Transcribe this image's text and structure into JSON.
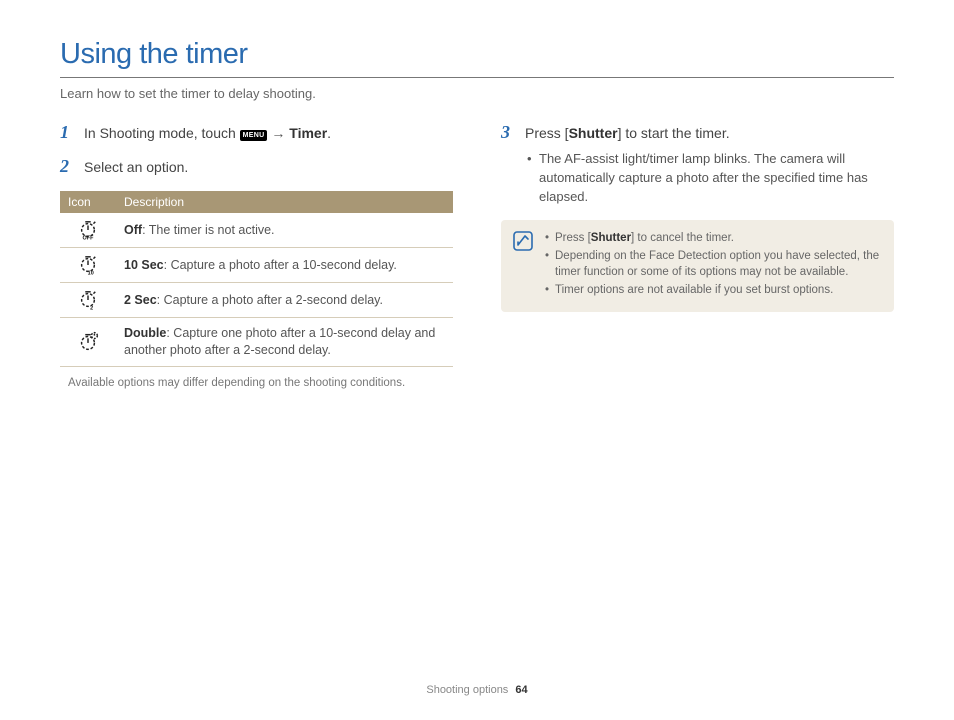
{
  "title": "Using the timer",
  "intro": "Learn how to set the timer to delay shooting.",
  "steps": {
    "s1": {
      "num": "1",
      "pre": "In Shooting mode, touch ",
      "menu": "MENU",
      "arrow": " → ",
      "target": "Timer",
      "post": "."
    },
    "s2": {
      "num": "2",
      "text": "Select an option."
    },
    "s3": {
      "num": "3",
      "pre": "Press [",
      "btn": "Shutter",
      "post": "] to start the timer.",
      "bullet": "The AF-assist light/timer lamp blinks. The camera will automatically capture a photo after the specified time has elapsed."
    }
  },
  "table": {
    "h1": "Icon",
    "h2": "Description",
    "rows": [
      {
        "label": "Off",
        "desc": ": The timer is not active."
      },
      {
        "label": "10 Sec",
        "desc": ": Capture a photo after a 10-second delay."
      },
      {
        "label": "2 Sec",
        "desc": ": Capture a photo after a 2-second delay."
      },
      {
        "label": "Double",
        "desc": ": Capture one photo after a 10-second delay and another photo after a 2-second delay."
      }
    ]
  },
  "caption": "Available options may differ depending on the shooting conditions.",
  "notes": {
    "n1_pre": "Press [",
    "n1_btn": "Shutter",
    "n1_post": "] to cancel the timer.",
    "n2": "Depending on the Face Detection option you have selected, the timer function or some of its options may not be available.",
    "n3": "Timer options are not available if you set burst options."
  },
  "footer": {
    "section": "Shooting options",
    "page": "64"
  }
}
